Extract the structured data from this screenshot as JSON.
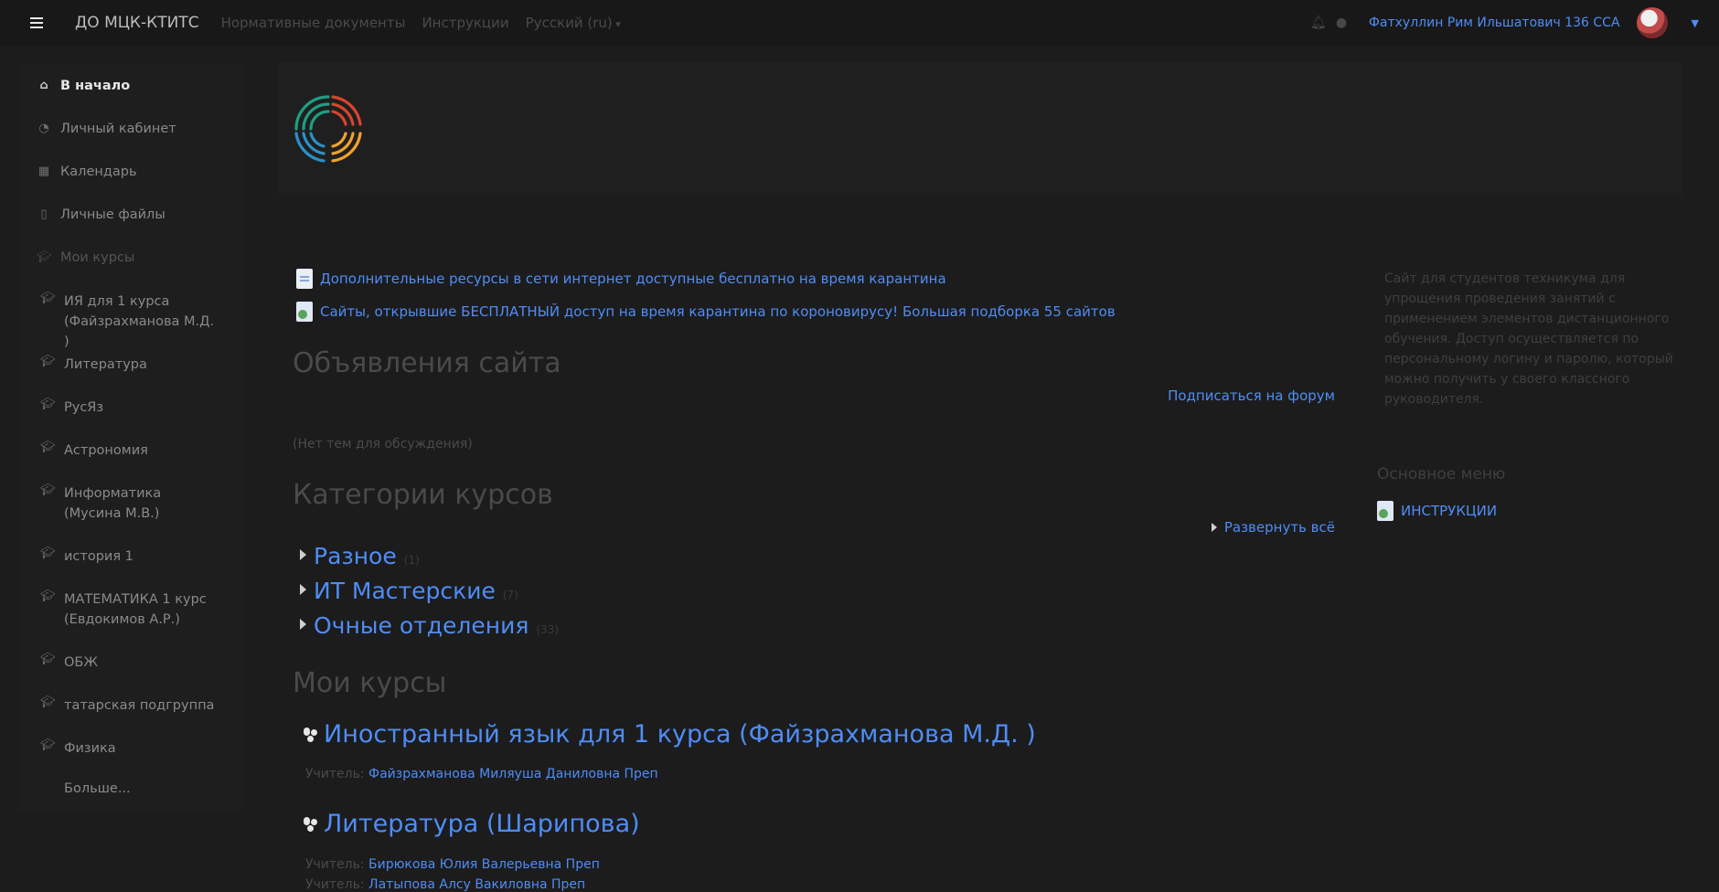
{
  "navbar": {
    "brand": "ДО МЦК-КТИТС",
    "links": [
      "Нормативные документы",
      "Инструкции",
      "Русский (ru)"
    ],
    "user_name": "Фатхуллин Рим Ильшатович 136 ССА"
  },
  "sidebar": {
    "items": [
      {
        "label": "В начало",
        "icon": "home-icon"
      },
      {
        "label": "Личный кабинет",
        "icon": "dashboard-icon"
      },
      {
        "label": "Календарь",
        "icon": "calendar-icon"
      },
      {
        "label": "Личные файлы",
        "icon": "file-icon"
      },
      {
        "label": "Мои курсы",
        "icon": "graduation-cap-icon"
      }
    ],
    "courses": [
      "ИЯ для 1 курса (Файзрахманова М.Д. )",
      "Литература",
      "РусЯз",
      "Астрономия",
      "Информатика (Мусина М.В.)",
      "история 1",
      "МАТЕМАТИКА 1 курс (Евдокимов А.Р.)",
      "ОБЖ",
      "татарская подгруппа",
      "Физика"
    ],
    "more": "Больше..."
  },
  "main": {
    "resources": [
      "Дополнительные ресурсы в сети интернет доступные бесплатно на время карантина",
      "Сайты, открывшие БЕСПЛАТНЫЙ доступ на время карантина по короновирусу! Большая подборка 55 сайтов"
    ],
    "announcements_title": "Объявления сайта",
    "subscribe_label": "Подписаться на форум",
    "no_topics": "(Нет тем для обсуждения)",
    "categories_title": "Категории курсов",
    "expand_all": "Развернуть всё",
    "categories": [
      {
        "name": "Разное",
        "count": "(1)"
      },
      {
        "name": "ИТ Мастерские",
        "count": "(7)"
      },
      {
        "name": "Очные отделения",
        "count": "(33)"
      }
    ],
    "my_courses_title": "Мои курсы",
    "courses": [
      {
        "title": "Иностранный язык для 1 курса (Файзрахманова М.Д. )",
        "teacher_label": "Учитель:",
        "teacher": "Файзрахманова Миляуша Даниловна Преп"
      },
      {
        "title": "Литература (Шарипова)",
        "teacher_label": "Учитель:",
        "teacher": "Бирюкова Юлия Валерьевна Преп",
        "teacher2": "Латыпова Алсу Вакиловна Преп"
      }
    ]
  },
  "aside": {
    "description": "Сайт для студентов техникума для упрощения проведения занятий с применением элементов дистанционного обучения. Доступ осуществляется по персональному логину и паролю, который можно получить у своего классного руководителя.",
    "main_menu_title": "Основное меню",
    "main_menu_link": "ИНСТРУКЦИИ"
  },
  "colors": {
    "background": "#1c1c1d",
    "link": "#4f8df5",
    "muted": "#4a4a4a"
  }
}
